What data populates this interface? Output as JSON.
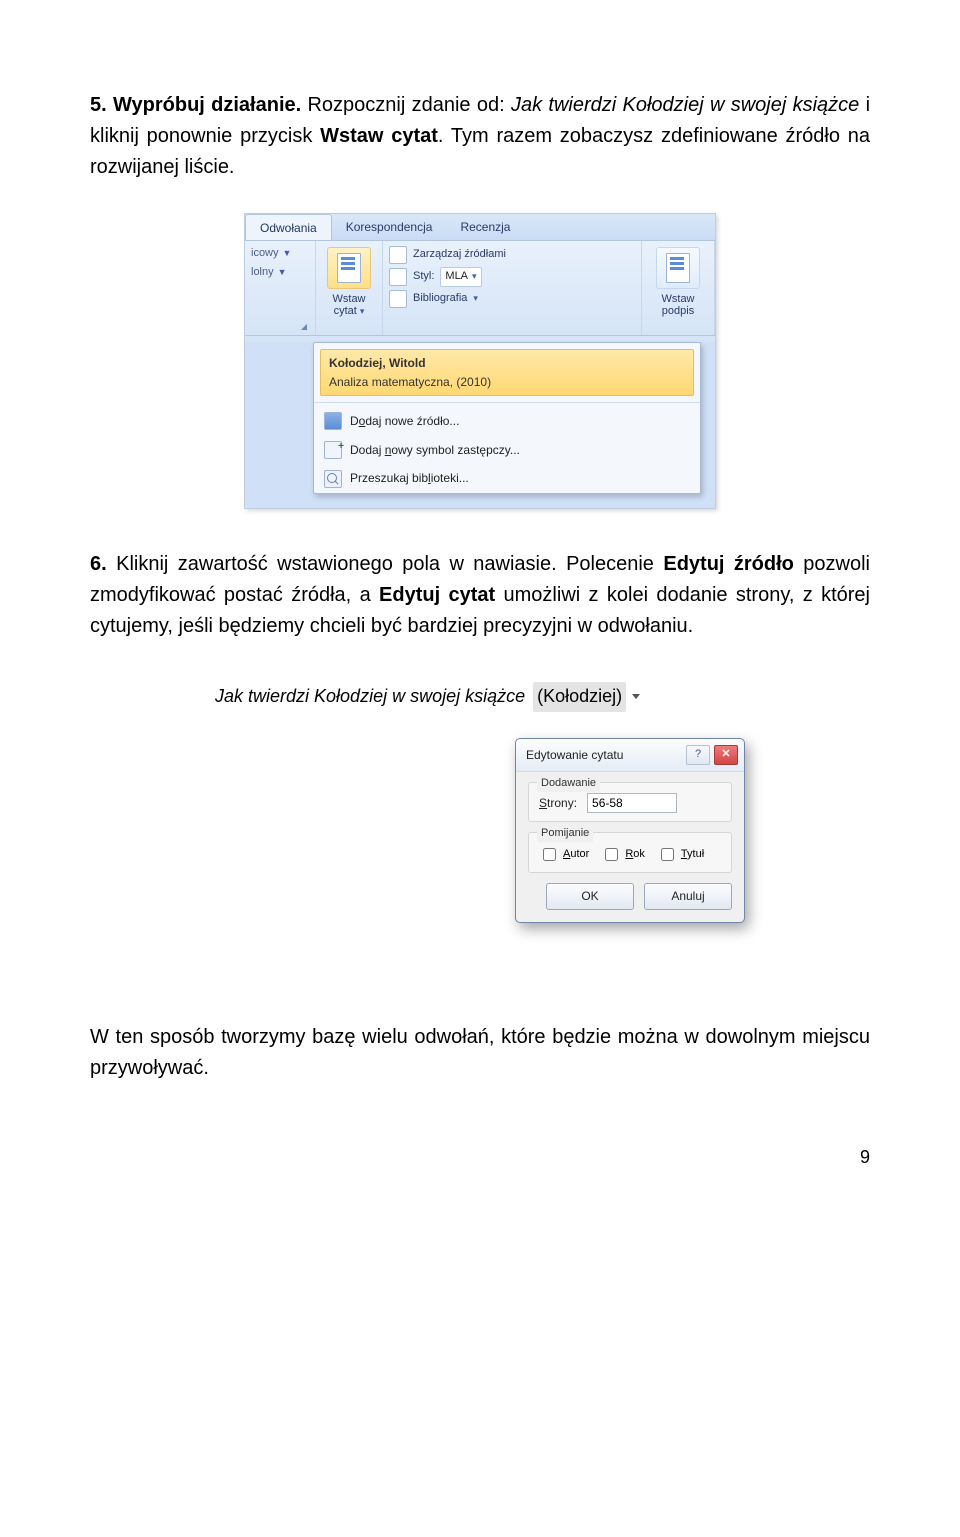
{
  "step5": {
    "num": "5.",
    "lead": "Wypróbuj działanie.",
    "text1": " Rozpocznij zdanie od: ",
    "italic": "Jak twierdzi Kołodziej w swojej książce",
    "text2": " i kliknij ponownie przycisk ",
    "bold": "Wstaw cytat",
    "text3": ". Tym razem zobaczysz zdefiniowane źródło na rozwijanej liście."
  },
  "ribbon": {
    "tabs": {
      "active": "Odwołania",
      "t2": "Korespondencja",
      "t3": "Recenzja"
    },
    "grp1": {
      "l1": "icowy",
      "l2": "lolny"
    },
    "insertCitation": {
      "l1": "Wstaw",
      "l2": "cytat"
    },
    "grp3": {
      "manage": "Zarządzaj źródłami",
      "styleLabel": "Styl:",
      "styleValue": "MLA",
      "biblio": "Bibliografia"
    },
    "insertCaption": {
      "l1": "Wstaw",
      "l2": "podpis"
    },
    "dropdown": {
      "sel_l1": "Kołodziej, Witold",
      "sel_l2": "Analiza matematyczna, (2010)",
      "addSource_pre": "D",
      "addSource_u": "o",
      "addSource_post": "daj nowe źródło...",
      "addPlaceholder_pre": "Dodaj ",
      "addPlaceholder_u": "n",
      "addPlaceholder_post": "owy symbol zastępczy...",
      "search_pre": "Przeszukaj bib",
      "search_u": "l",
      "search_post": "ioteki..."
    }
  },
  "step6": {
    "num": "6.",
    "t1": " Kliknij zawartość wstawionego pola w nawiasie. Polecenie ",
    "b1": "Edytuj źródło",
    "t2": " pozwoli zmodyfikować postać źródła, a ",
    "b2": "Edytuj cytat",
    "t3": " umożliwi z kolei dodanie strony, z której cytujemy, jeśli będziemy chcieli być bardziej precyzyjni w odwołaniu."
  },
  "editShot": {
    "sentence_it": "Jak twierdzi Kołodziej w swojej książce",
    "citation": "(Kołodziej)",
    "dialog": {
      "title": "Edytowanie cytatu",
      "grp1": "Dodawanie",
      "pageLabel_pre": "",
      "pageLabel_u": "S",
      "pageLabel_post": "trony:",
      "pageValue": "56-58",
      "grp2": "Pomijanie",
      "author_u": "A",
      "author_post": "utor",
      "year_u": "R",
      "year_post": "ok",
      "title_u": "T",
      "title_post": "ytuł",
      "ok": "OK",
      "cancel": "Anuluj"
    }
  },
  "closing": "W ten sposób tworzymy bazę wielu odwołań, które będzie można w dowolnym miejscu przywoływać.",
  "pageNumber": "9"
}
